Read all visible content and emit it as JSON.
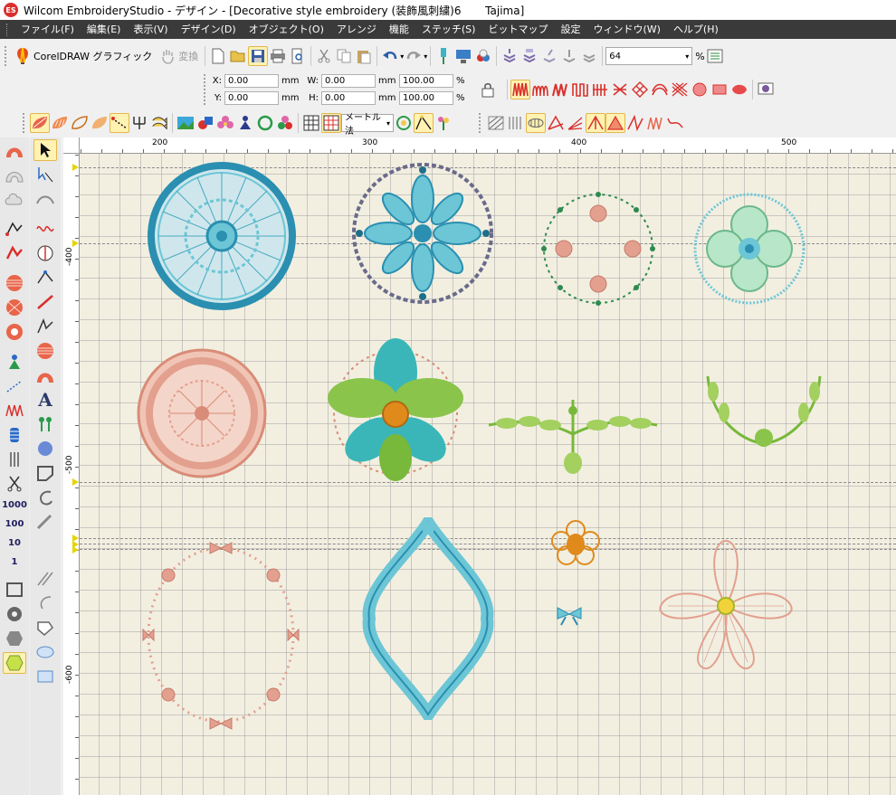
{
  "window": {
    "logo_text": "ES",
    "title": "Wilcom EmbroideryStudio - デザイン - [Decorative style embroidery (装飾風刺繍)6       Tajima]"
  },
  "menu": [
    "ファイル(F)",
    "編集(E)",
    "表示(V)",
    "デザイン(D)",
    "オブジェクト(O)",
    "アレンジ",
    "機能",
    "ステッチ(S)",
    "ビットマップ",
    "設定",
    "ウィンドウ(W)",
    "ヘルプ(H)"
  ],
  "toolbar": {
    "coreldraw_label": "CorelDRAW グラフィック",
    "convert_label": "変換",
    "zoom_value": "64",
    "zoom_unit": "%"
  },
  "transform": {
    "x_label": "X:",
    "x_value": "0.00",
    "x_unit": "mm",
    "y_label": "Y:",
    "y_value": "0.00",
    "y_unit": "mm",
    "w_label": "W:",
    "w_value": "0.00",
    "w_unit": "mm",
    "h_label": "H:",
    "h_value": "0.00",
    "h_unit": "mm",
    "sx_value": "100.00",
    "sx_unit": "%",
    "sy_value": "100.00",
    "sy_unit": "%"
  },
  "stitch_method": {
    "value": "メートル法"
  },
  "sidebar_counts": [
    "1000",
    "100",
    "10",
    "1"
  ],
  "ruler": {
    "h_labels": [
      "200",
      "300",
      "400",
      "500"
    ],
    "v_labels": [
      "-400",
      "-500",
      "-600"
    ]
  },
  "colors": {
    "teal": "#2a8fb0",
    "light_teal": "#6cc6d6",
    "salmon": "#e3a08e",
    "green": "#78b83a",
    "dark_green": "#2e8a50",
    "orange": "#e08a1c",
    "navy": "#3a3a6a"
  },
  "icons": [
    "save-icon",
    "open-icon",
    "new-icon",
    "print-icon",
    "undo-icon",
    "redo-icon",
    "cut-icon",
    "copy-icon",
    "paste-icon",
    "select-icon",
    "text-icon"
  ]
}
